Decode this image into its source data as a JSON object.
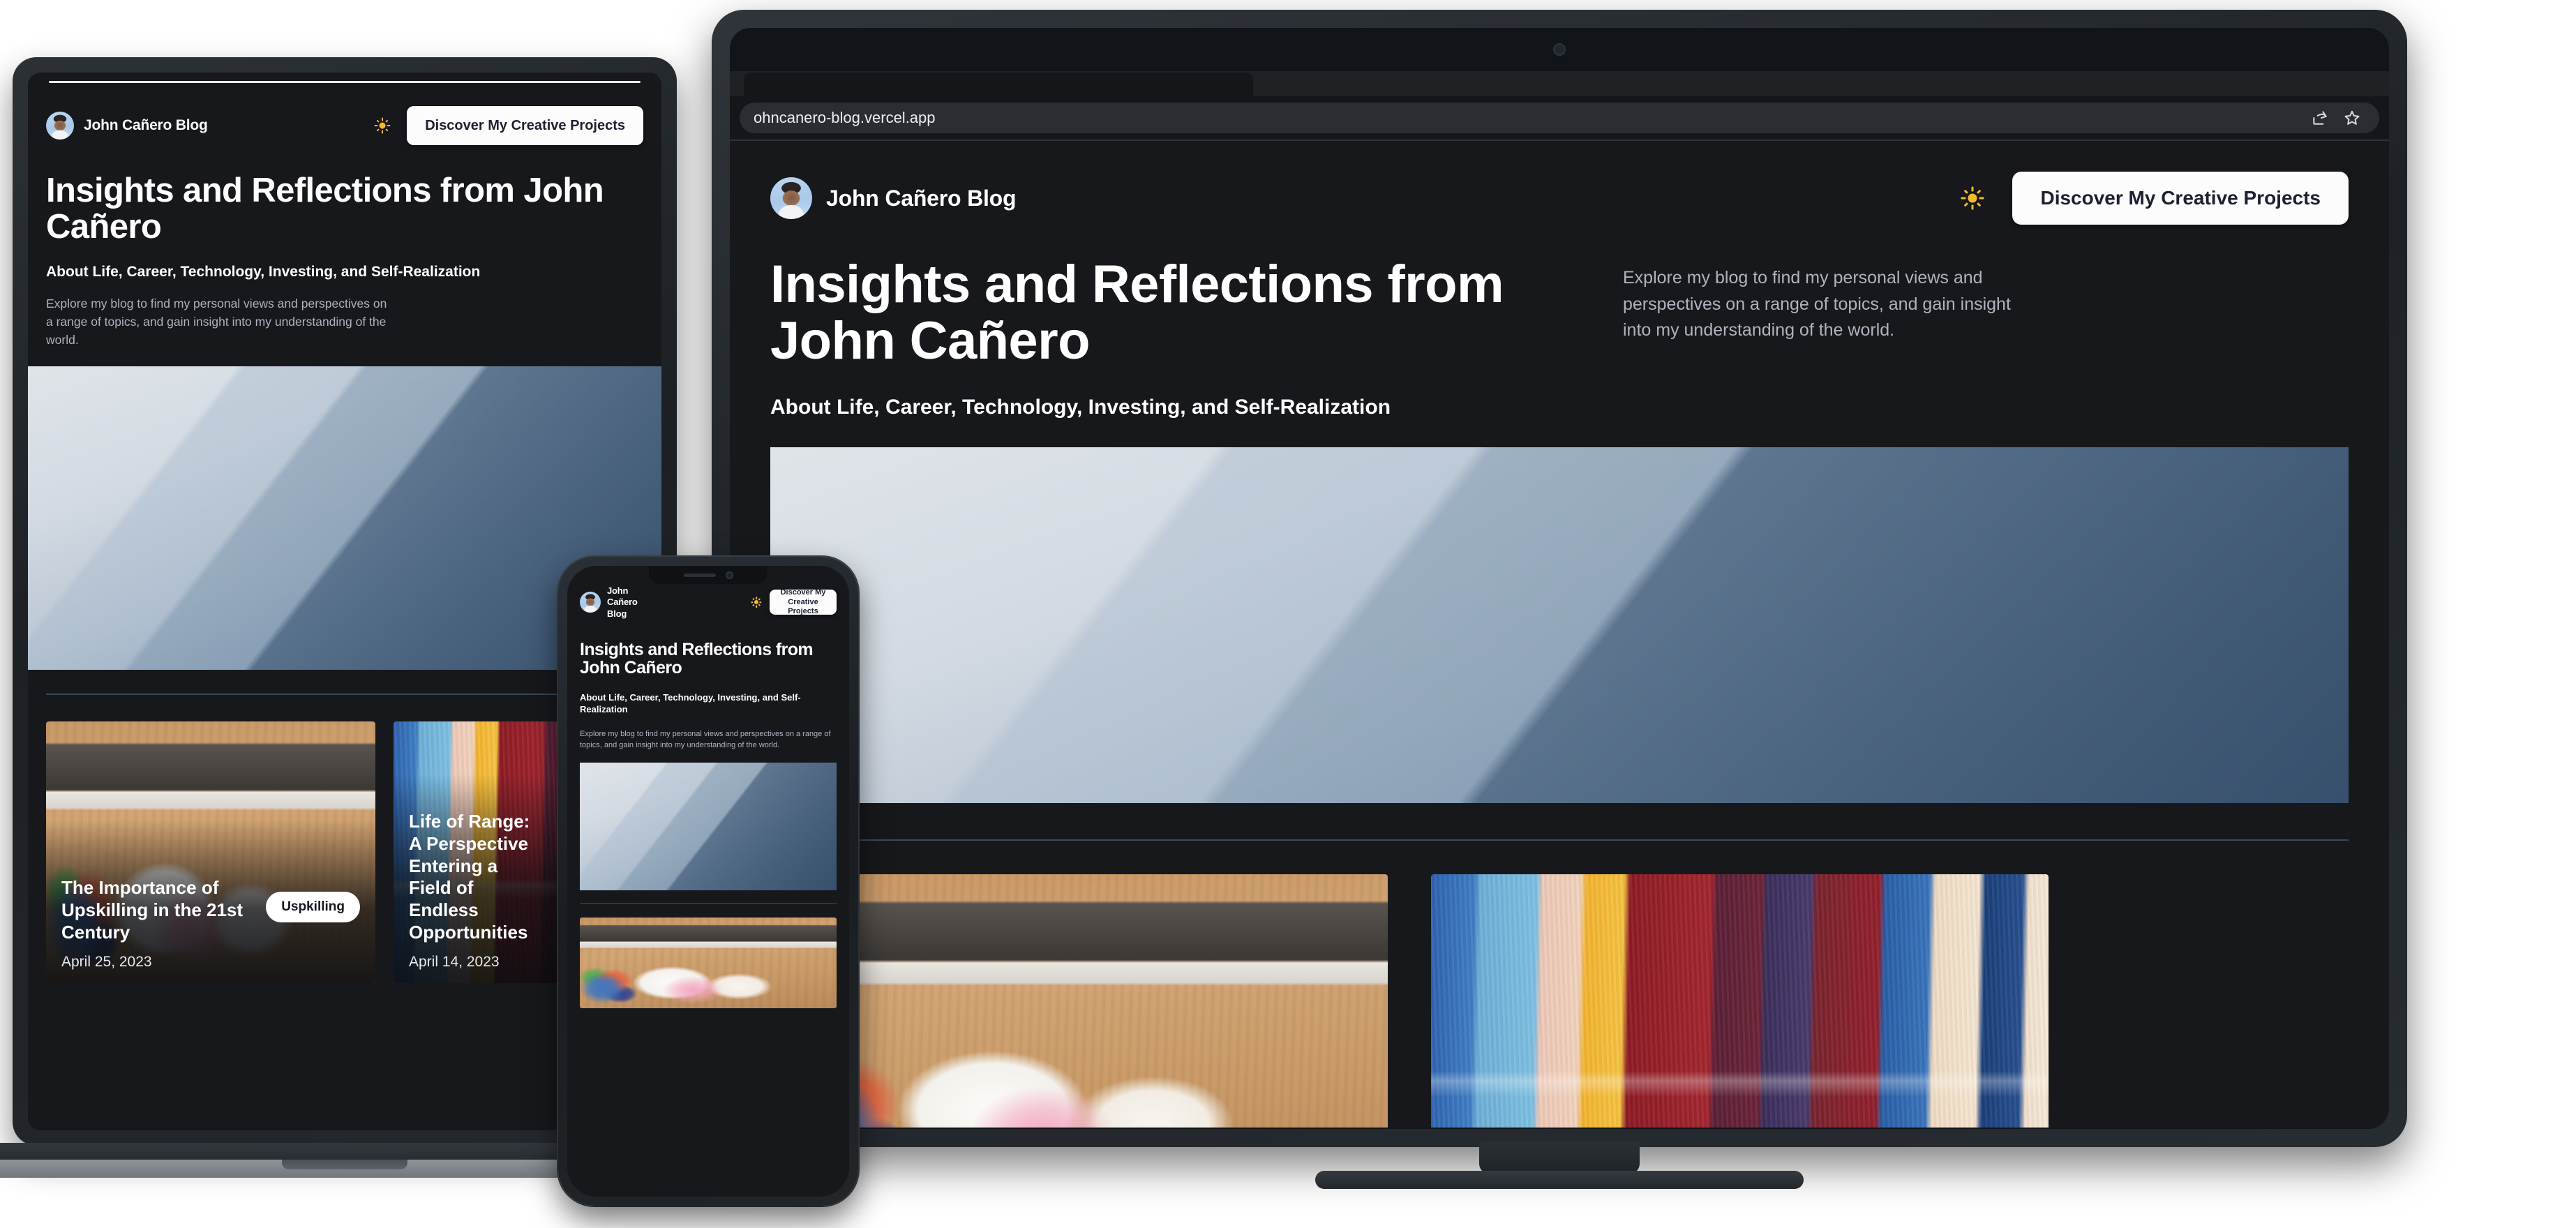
{
  "browser": {
    "url": "ohncanero-blog.vercel.app",
    "share_icon": "share-icon",
    "bookmark_icon": "star-icon"
  },
  "site": {
    "brand": {
      "name": "John Cañero Blog",
      "avatar_alt": "John Cañero avatar"
    },
    "theme_toggle_icon": "sun-icon",
    "cta_label": "Discover My Creative Projects",
    "hero": {
      "title": "Insights and Reflections from John Cañero",
      "subtitle": "About Life, Career, Technology, Investing, and Self-Realization",
      "description": "Explore my blog to find my personal views and perspectives on a range of topics, and gain insight into my understanding of the world.",
      "image_alt": "misty layered mountain ridges"
    },
    "posts": [
      {
        "title": "The Importance of Upskilling in the 21st Century",
        "date": "April 25, 2023",
        "tag": "Uspkilling",
        "image_alt": "desk with iMac, papers and highlighters"
      },
      {
        "title": "Life of Range: A Perspective Entering a Field of Endless Opportunities",
        "date": "April 14, 2023",
        "tag": "",
        "image_alt": "abstract acrylic painting in blue, yellow and red"
      }
    ]
  },
  "colors": {
    "page_bg": "#17181c",
    "accent_sun": "#f3b92e",
    "cta_bg": "#fcfcfc",
    "cta_text": "#1c2030",
    "body_text": "#aeb3bd",
    "divider": "#3a4a5a"
  }
}
